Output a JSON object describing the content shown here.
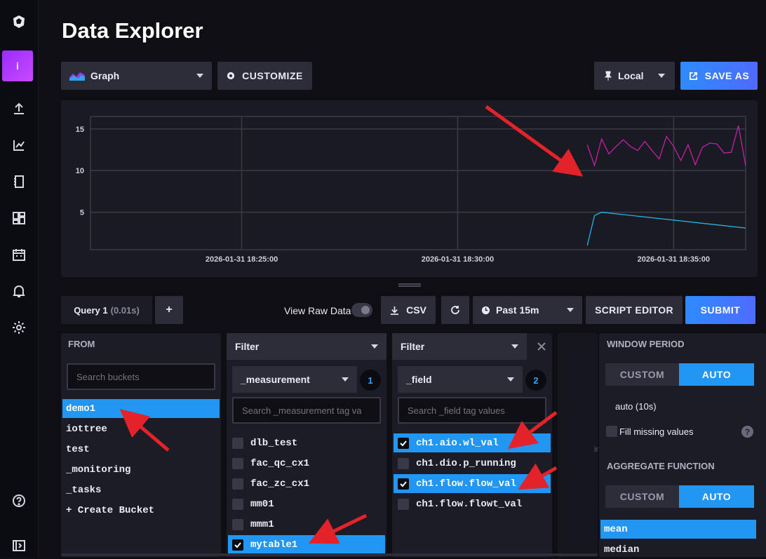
{
  "page": {
    "title": "Data Explorer"
  },
  "toolbar": {
    "vis_type": "Graph",
    "customize_label": "CUSTOMIZE",
    "timezone": "Local",
    "save_as_label": "SAVE AS"
  },
  "chart_data": {
    "type": "line",
    "y_ticks": [
      "15",
      "10",
      "5"
    ],
    "ylim": [
      0.5,
      16.5
    ],
    "x_ticks": [
      "2026-01-31 18:25:00",
      "2026-01-31 18:30:00",
      "2026-01-31 18:35:00"
    ],
    "x_range": [
      "2026-01-31 18:21:30",
      "2026-01-31 18:36:40"
    ],
    "series": [
      {
        "color": "#c51fa9",
        "x": [
          "18:33:00",
          "18:33:10",
          "18:33:20",
          "18:33:30",
          "18:33:40",
          "18:33:50",
          "18:34:00",
          "18:34:10",
          "18:34:20",
          "18:34:30",
          "18:34:40",
          "18:34:50",
          "18:35:00",
          "18:35:10",
          "18:35:20",
          "18:35:30",
          "18:35:40",
          "18:35:50",
          "18:36:00",
          "18:36:10",
          "18:36:20",
          "18:36:30",
          "18:36:40"
        ],
        "values": [
          13.1,
          10.6,
          13.8,
          12.0,
          12.9,
          13.7,
          12.9,
          12.4,
          13.5,
          12.4,
          11.4,
          14.1,
          12.9,
          11.2,
          13.1,
          10.7,
          12.8,
          13.3,
          13.2,
          12.1,
          12.2,
          15.4,
          10.6
        ]
      },
      {
        "color": "#22b6e8",
        "x": [
          "18:33:00",
          "18:33:10",
          "18:33:20",
          "18:36:40"
        ],
        "values": [
          1.0,
          4.6,
          5.0,
          3.1
        ]
      }
    ]
  },
  "query": {
    "tab_label": "Query 1",
    "tab_time": "(0.01s)",
    "add_label": "+",
    "view_raw_label": "View Raw Data",
    "csv_label": "CSV",
    "time_range": "Past 15m",
    "script_editor_label": "SCRIPT EDITOR",
    "submit_label": "SUBMIT"
  },
  "from_panel": {
    "header": "FROM",
    "search_placeholder": "Search buckets",
    "buckets": [
      "demo1",
      "iottree",
      "test",
      "_monitoring",
      "_tasks",
      "+ Create Bucket"
    ],
    "selected_index": 0
  },
  "filter1": {
    "header": "Filter",
    "key": "_measurement",
    "badge": "1",
    "search_placeholder": "Search _measurement tag va",
    "values": [
      {
        "label": "dlb_test",
        "checked": false
      },
      {
        "label": "fac_qc_cx1",
        "checked": false
      },
      {
        "label": "fac_zc_cx1",
        "checked": false
      },
      {
        "label": "mm01",
        "checked": false
      },
      {
        "label": "mmm1",
        "checked": false
      },
      {
        "label": "mytable1",
        "checked": true
      }
    ]
  },
  "filter2": {
    "header": "Filter",
    "key": "_field",
    "badge": "2",
    "search_placeholder": "Search _field tag values",
    "values": [
      {
        "label": "ch1.aio.wl_val",
        "checked": true
      },
      {
        "label": "ch1.dio.p_running",
        "checked": false
      },
      {
        "label": "ch1.flow.flow_val",
        "checked": true
      },
      {
        "label": "ch1.flow.flowt_val",
        "checked": false
      }
    ]
  },
  "empty_panel_text": "ir",
  "aggregate": {
    "window_header": "WINDOW PERIOD",
    "custom_label": "CUSTOM",
    "auto_label": "AUTO",
    "auto_value": "auto (10s)",
    "fill_missing_label": "Fill missing values",
    "help_icon_label": "?",
    "function_header": "AGGREGATE FUNCTION",
    "functions": [
      "mean",
      "median"
    ],
    "selected_function": "mean"
  }
}
